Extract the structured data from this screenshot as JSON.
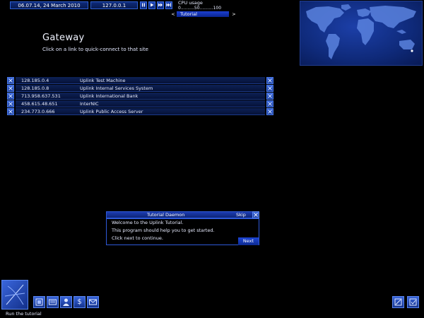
{
  "topbar": {
    "datetime": "06.07.14, 24 March 2010",
    "ip": "127.0.0.1",
    "controls": [
      "pause-icon",
      "play-icon",
      "fast-forward-icon",
      "faster-icon"
    ]
  },
  "cpu": {
    "title": "CPU usage",
    "scale": "0..........50..........100",
    "nav_prev": "<",
    "nav_label": "Tutorial",
    "nav_next": ">"
  },
  "page": {
    "title": "Gateway",
    "subtitle": "Click on a link to quick-connect to that site"
  },
  "links": [
    {
      "ip": "128.185.0.4",
      "name": "Uplink Test Machine"
    },
    {
      "ip": "128.185.0.8",
      "name": "Uplink Internal Services System"
    },
    {
      "ip": "713.958.637.531",
      "name": "Uplink International Bank"
    },
    {
      "ip": "458.615.48.651",
      "name": "InterNIC"
    },
    {
      "ip": "234.773.0.666",
      "name": "Uplink Public Access Server"
    }
  ],
  "daemon": {
    "title": "Tutorial Daemon",
    "skip": "Skip",
    "lines": [
      "Welcome to the Uplink Tutorial.",
      "This program should help you to get started.",
      "Click next to continue."
    ],
    "next": "Next"
  },
  "toolbar": {
    "tools": [
      "software-icon",
      "hardware-icon",
      "email-icon",
      "finance-icon",
      "bbs-icon"
    ],
    "right_tools": [
      "memory-icon",
      "status-icon"
    ],
    "status": "Run the tutorial"
  },
  "colors": {
    "accent": "#1c3fd0",
    "panel": "#0d2155",
    "background": "#000000"
  }
}
